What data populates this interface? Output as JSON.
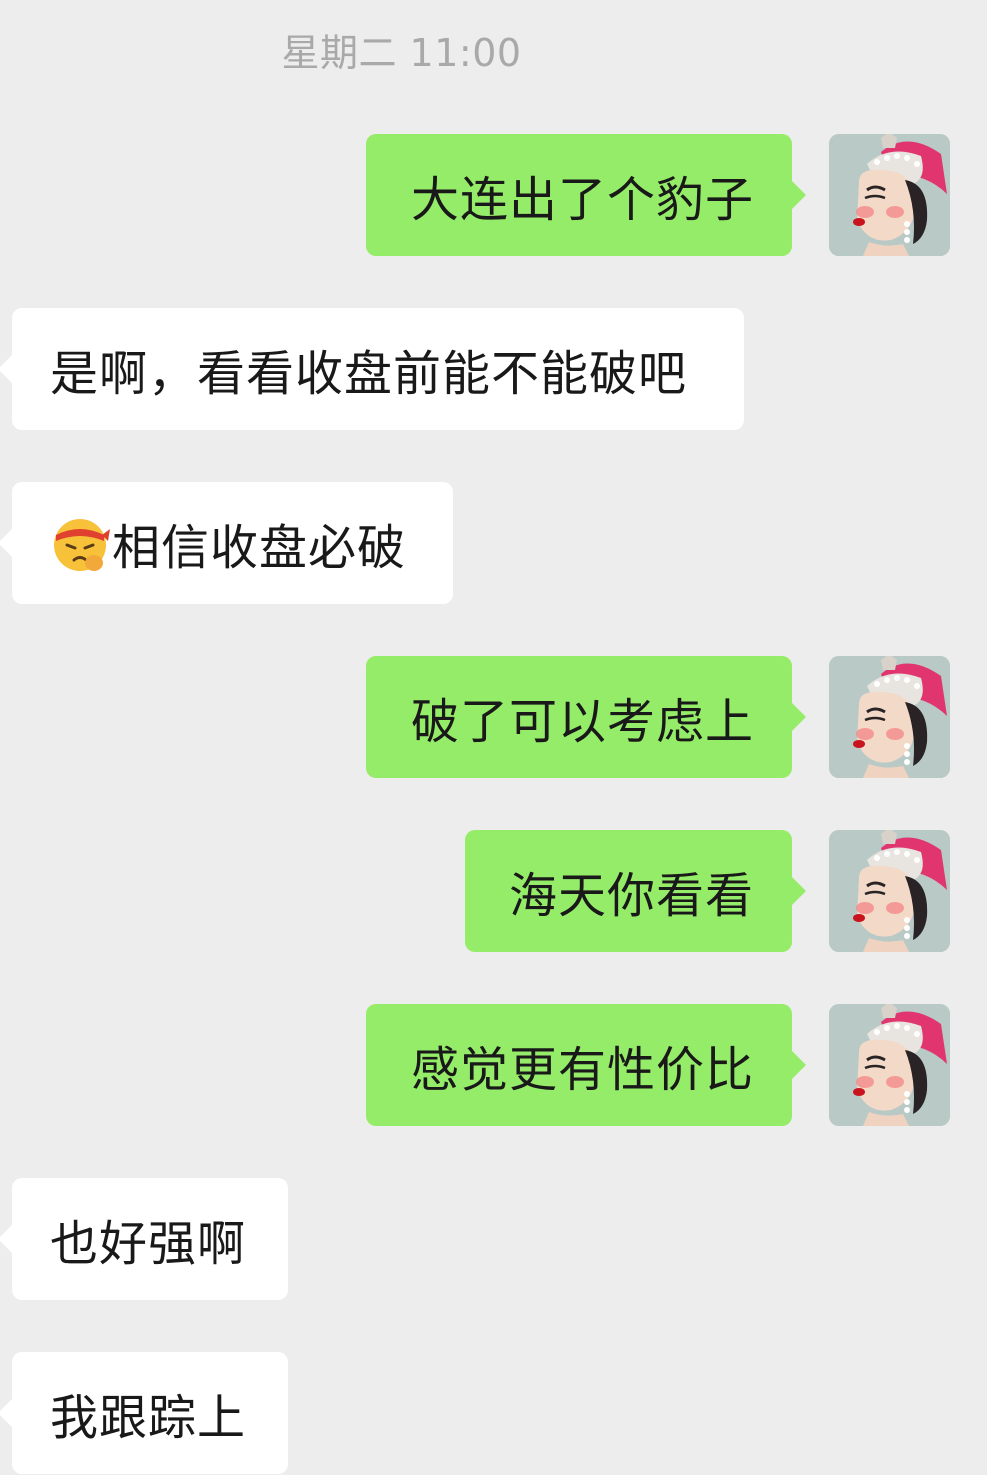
{
  "chat": {
    "timestamp": "星期二 11:00",
    "messages": [
      {
        "side": "sent",
        "text": "大连出了个豹子"
      },
      {
        "side": "received",
        "text": "是啊，看看收盘前能不能破吧"
      },
      {
        "side": "received",
        "icon": "determined-face-emoji-icon",
        "text": "相信收盘必破"
      },
      {
        "side": "sent",
        "text": "破了可以考虑上"
      },
      {
        "side": "sent",
        "text": "海天你看看"
      },
      {
        "side": "sent",
        "text": "感觉更有性价比"
      },
      {
        "side": "received",
        "text": "也好强啊"
      },
      {
        "side": "received",
        "text": "我跟踪上"
      }
    ]
  },
  "colors": {
    "background": "#ededed",
    "sent_bubble": "#95ec69",
    "received_bubble": "#ffffff",
    "timestamp_text": "#a9a9a9",
    "message_text": "#191919"
  }
}
